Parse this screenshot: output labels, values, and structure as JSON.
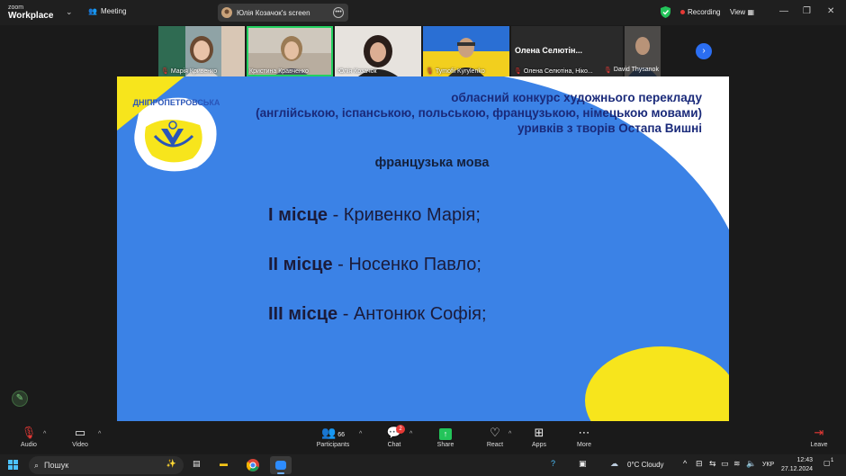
{
  "app": {
    "brand_line1": "zoom",
    "brand_line2": "Workplace",
    "meeting_label": "Meeting",
    "screen_title": "Юлія Козачок's screen",
    "recording_label": "Recording",
    "view_label": "View"
  },
  "participants": [
    {
      "name": "Марія Кривенко",
      "muted": true
    },
    {
      "name": "Кристина Кравченко",
      "muted": false,
      "active": true
    },
    {
      "name": "Юлія Козачок",
      "muted": false
    },
    {
      "name": "Tymofii Kyrylenko",
      "muted": true
    },
    {
      "name": "Олена Селютіна, Ніко...",
      "muted": true,
      "display_title": "Олена Селютін..."
    },
    {
      "name": "David Thysanok",
      "muted": true
    }
  ],
  "slide": {
    "title_line1": "обласний конкурс художнього перекладу",
    "title_line2": "(англійською, іспанською, польською, французькою, німецькою мовами)",
    "title_line3": "уривків з творів Остапа Вишні",
    "logo_text": "ДНІПРОПЕТРОВСЬКА",
    "subtitle": "французька мова",
    "places": [
      {
        "rank": "I місце",
        "name": "- Кривенко Марія;"
      },
      {
        "rank": "II місце",
        "name": "- Носенко Павло;"
      },
      {
        "rank": "III місце",
        "name": "- Антонюк Софія;"
      }
    ],
    "colors": {
      "blue": "#3b82e6",
      "yellow": "#f7e51c",
      "text": "#1b1b3a"
    }
  },
  "toolbar": {
    "audio": "Audio",
    "video": "Video",
    "participants": "Participants",
    "participants_count": "66",
    "chat": "Chat",
    "chat_badge": "2",
    "share": "Share",
    "react": "React",
    "apps": "Apps",
    "more": "More",
    "leave": "Leave"
  },
  "taskbar": {
    "search_placeholder": "Пошук",
    "weather": "0°C  Cloudy",
    "language": "УКР",
    "time": "12:43",
    "date": "27.12.2024",
    "notification_count": "1"
  }
}
